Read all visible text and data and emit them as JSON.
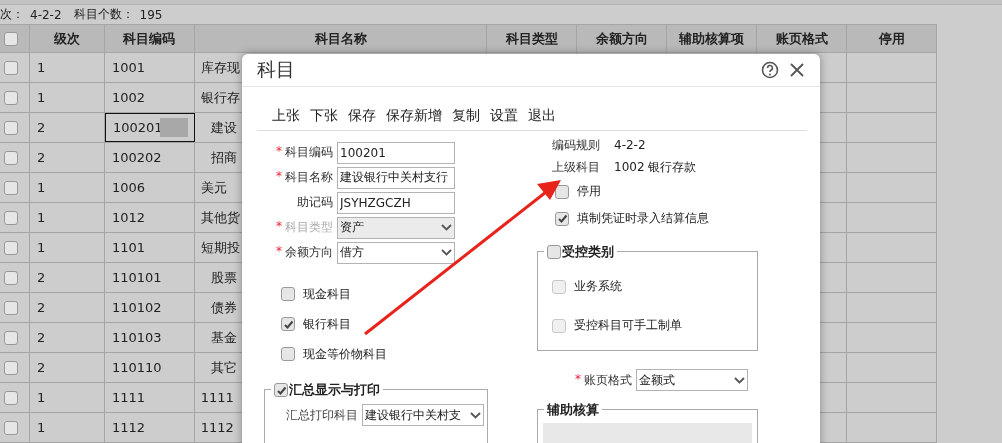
{
  "info": {
    "level_label": "次：",
    "level_value": "4-2-2",
    "count_label": "科目个数：",
    "count_value": "195"
  },
  "table": {
    "select_all": {
      "checked": false
    },
    "columns": [
      "级次",
      "科目编码",
      "科目名称",
      "科目类型",
      "余额方向",
      "辅助核算项",
      "账页格式",
      "停用"
    ],
    "rows": [
      {
        "checked": false,
        "level": "1",
        "code": "1001",
        "name": "库存现",
        "child": false,
        "focused": false
      },
      {
        "checked": false,
        "level": "1",
        "code": "1002",
        "name": "银行存",
        "child": false,
        "focused": false
      },
      {
        "checked": false,
        "level": "2",
        "code": "100201",
        "name": "建设",
        "child": true,
        "focused": true
      },
      {
        "checked": false,
        "level": "2",
        "code": "100202",
        "name": "招商",
        "child": true,
        "focused": false
      },
      {
        "checked": false,
        "level": "1",
        "code": "1006",
        "name": "美元",
        "child": false,
        "focused": false
      },
      {
        "checked": false,
        "level": "1",
        "code": "1012",
        "name": "其他货",
        "child": false,
        "focused": false
      },
      {
        "checked": false,
        "level": "1",
        "code": "1101",
        "name": "短期投",
        "child": false,
        "focused": false
      },
      {
        "checked": false,
        "level": "2",
        "code": "110101",
        "name": "股票",
        "child": true,
        "focused": false
      },
      {
        "checked": false,
        "level": "2",
        "code": "110102",
        "name": "债券",
        "child": true,
        "focused": false
      },
      {
        "checked": false,
        "level": "2",
        "code": "110103",
        "name": "基金",
        "child": true,
        "focused": false
      },
      {
        "checked": false,
        "level": "2",
        "code": "110110",
        "name": "其它",
        "child": true,
        "focused": false
      },
      {
        "checked": false,
        "level": "1",
        "code": "1111",
        "name": "1111",
        "child": false,
        "focused": false
      },
      {
        "checked": false,
        "level": "1",
        "code": "1112",
        "name": "1112",
        "child": false,
        "focused": false
      }
    ]
  },
  "dialog": {
    "title": "科目",
    "toolbar": [
      "上张",
      "下张",
      "保存",
      "保存新增",
      "复制",
      "设置",
      "退出"
    ],
    "fields": [
      {
        "label": "科目编码",
        "required_mark": "*",
        "kind": "text",
        "value": "100201",
        "disabled": false
      },
      {
        "label": "科目名称",
        "required_mark": "*",
        "kind": "text",
        "value": "建设银行中关村支行",
        "disabled": false
      },
      {
        "label": "助记码",
        "kind": "text",
        "value": "JSYHZGCZH",
        "disabled": false
      },
      {
        "label": "科目类型",
        "required_mark": "*",
        "kind": "select",
        "value": "资产",
        "disabled": true
      },
      {
        "label": "余额方向",
        "required_mark": "*",
        "kind": "select",
        "value": "借方",
        "disabled": false
      }
    ],
    "options": [
      {
        "label": "现金科目",
        "checked": false
      },
      {
        "label": "银行科目",
        "checked": true
      },
      {
        "label": "现金等价物科目",
        "checked": false
      }
    ],
    "summary": {
      "legend": "汇总显示与打印",
      "checked": true,
      "label": "汇总打印科目",
      "value": "建设银行中关村支"
    },
    "info": [
      {
        "label": "编码规则",
        "value": "4-2-2"
      },
      {
        "label": "上级科目",
        "value": "1002 银行存款"
      }
    ],
    "flags": [
      {
        "label": "停用",
        "checked": false
      },
      {
        "label": "填制凭证时录入结算信息",
        "checked": true
      }
    ],
    "control": {
      "legend": "受控类别",
      "checked": false,
      "items": [
        {
          "label": "业务系统",
          "checked": false,
          "disabled": true
        },
        {
          "label": "受控科目可手工制单",
          "checked": false,
          "disabled": true
        }
      ]
    },
    "ledger": {
      "label": "账页格式",
      "required_mark": "*",
      "value": "金额式"
    },
    "auxiliary": {
      "legend": "辅助核算"
    }
  }
}
